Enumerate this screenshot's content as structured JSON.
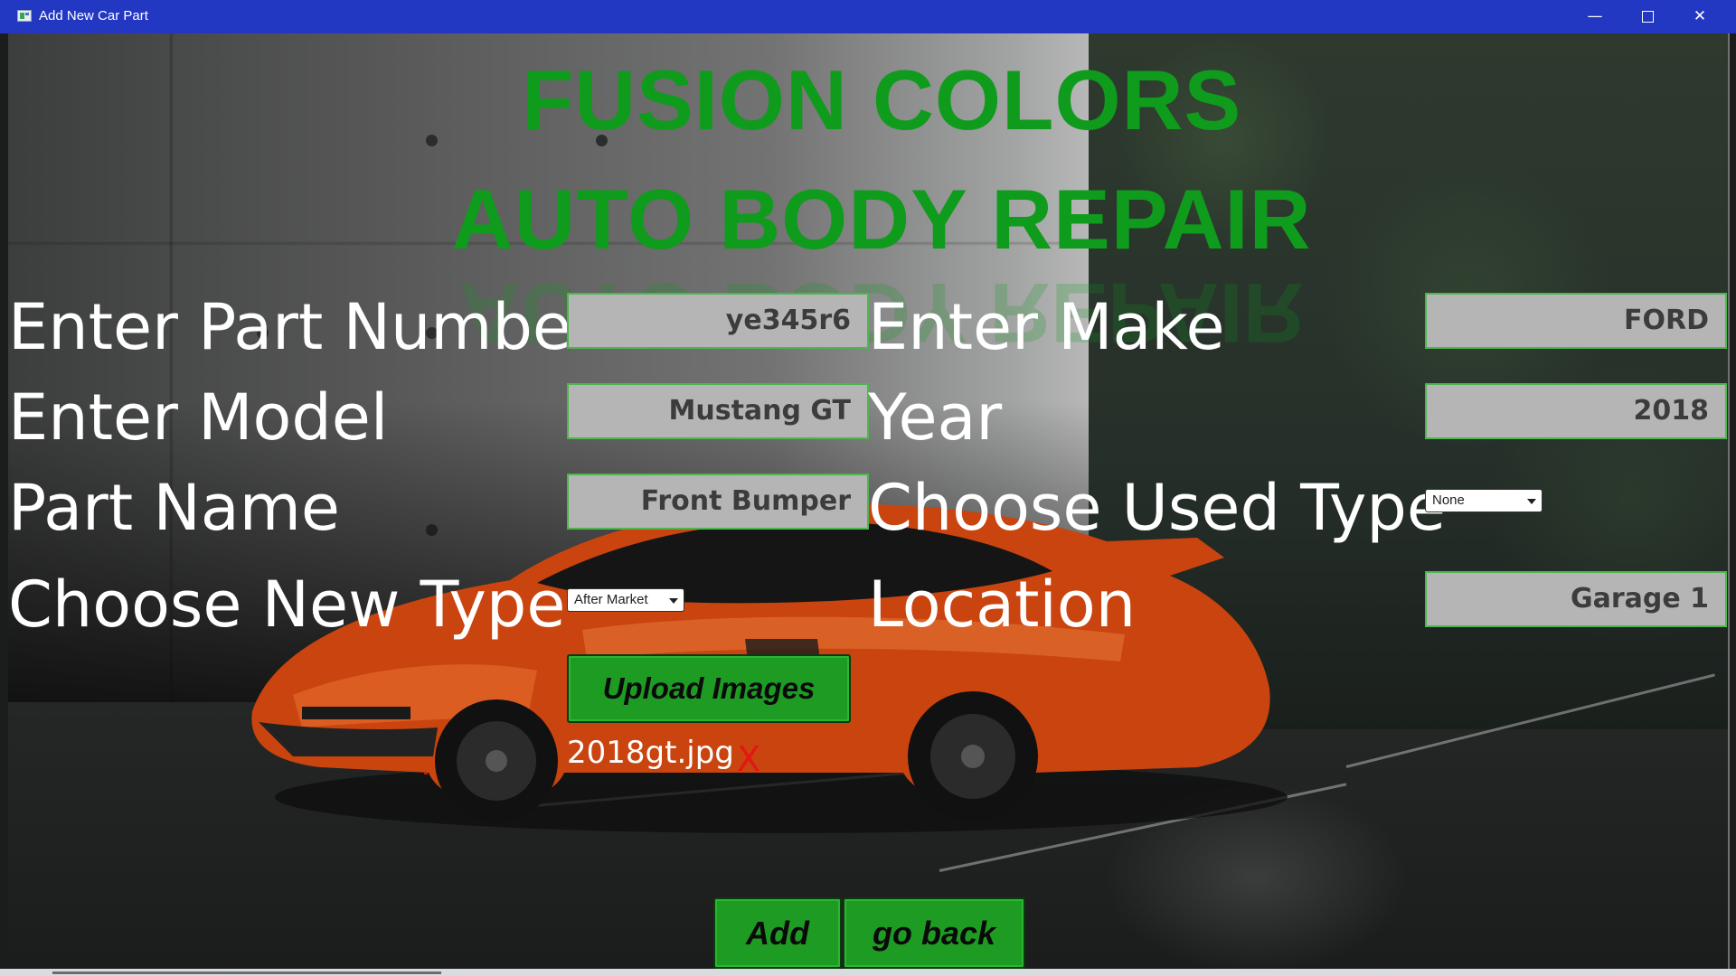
{
  "window": {
    "title": "Add New Car Part",
    "minimize_glyph": "—",
    "close_glyph": "✕",
    "icon": "app-window-icon"
  },
  "colors": {
    "titlebar": "#2237c2",
    "brand_green": "#0f9b1c",
    "button_green": "#1e9b23",
    "field_gray": "#b5b5b5",
    "remove_red": "#e51515"
  },
  "brand": {
    "line1": "FUSION COLORS",
    "line2": "AUTO BODY REPAIR"
  },
  "form": {
    "part_number": {
      "label": "Enter Part Number",
      "value": "ye345r6"
    },
    "make": {
      "label": "Enter Make",
      "value": "FORD"
    },
    "model": {
      "label": "Enter Model",
      "value": "Mustang GT"
    },
    "year": {
      "label": "Year",
      "value": "2018"
    },
    "part_name": {
      "label": "Part Name",
      "value": "Front Bumper"
    },
    "used_type": {
      "label": "Choose Used Type",
      "selected": "None"
    },
    "new_type": {
      "label": "Choose New Type",
      "selected": "After Market"
    },
    "location": {
      "label": "Location",
      "value": "Garage 1"
    }
  },
  "upload": {
    "button_label": "Upload Images",
    "file_name": "2018gt.jpg",
    "remove_label": "X"
  },
  "actions": {
    "add_label": "Add",
    "back_label": "go back"
  }
}
